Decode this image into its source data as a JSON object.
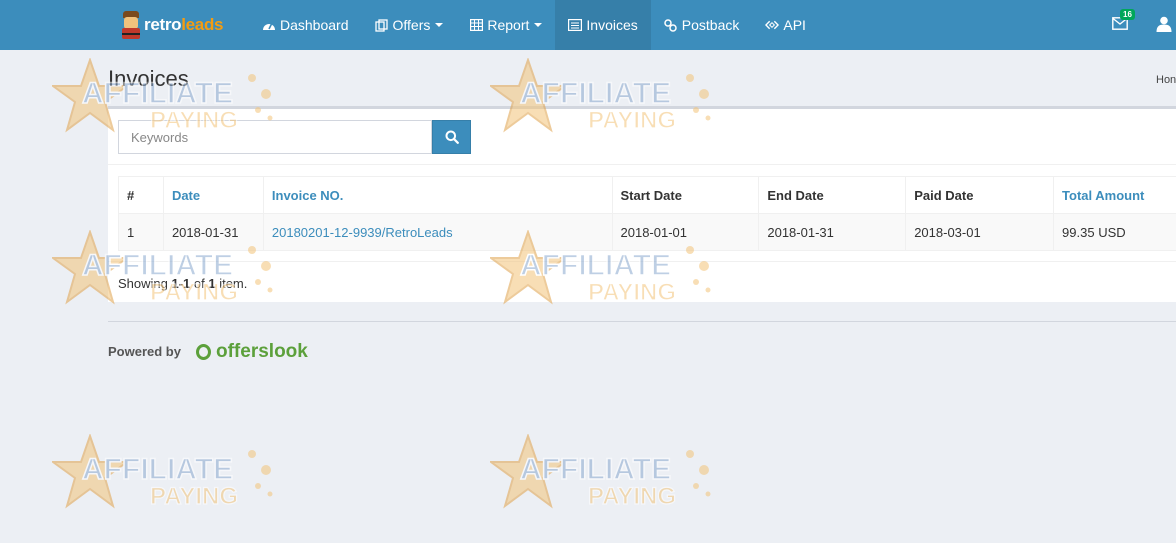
{
  "brand": {
    "part1": "retro",
    "part2": "leads"
  },
  "nav": {
    "items": [
      {
        "label": "Dashboard",
        "icon": "dashboard-icon",
        "dropdown": false,
        "active": false
      },
      {
        "label": "Offers",
        "icon": "offers-icon",
        "dropdown": true,
        "active": false
      },
      {
        "label": "Report",
        "icon": "table-icon",
        "dropdown": true,
        "active": false
      },
      {
        "label": "Invoices",
        "icon": "list-icon",
        "dropdown": false,
        "active": true
      },
      {
        "label": "Postback",
        "icon": "link-icon",
        "dropdown": false,
        "active": false
      },
      {
        "label": "API",
        "icon": "code-icon",
        "dropdown": false,
        "active": false
      }
    ],
    "mail_count": "16"
  },
  "page": {
    "title": "Invoices",
    "breadcrumb": "Hon"
  },
  "search": {
    "placeholder": "Keywords"
  },
  "table": {
    "headers": [
      "#",
      "Date",
      "Invoice NO.",
      "Start Date",
      "End Date",
      "Paid Date",
      "Total Amount"
    ],
    "rows": [
      [
        "1",
        "2018-01-31",
        "20180201-12-9939/RetroLeads",
        "2018-01-01",
        "2018-01-31",
        "2018-03-01",
        "99.35 USD"
      ]
    ]
  },
  "summary": {
    "prefix": "Showing ",
    "range": "1-1",
    "middle": " of ",
    "total": "1",
    "suffix": " item."
  },
  "footer": {
    "powered_by": "Powered by",
    "vendor": "offerslook"
  },
  "watermark": {
    "line1": "AFFILIATE",
    "line2": "PAYING"
  },
  "colors": {
    "navbar": "#3c8dbc",
    "active_nav": "#367fa9",
    "link": "#3c8dbc",
    "badge": "#00a65a",
    "vendor": "#5ca03b"
  }
}
